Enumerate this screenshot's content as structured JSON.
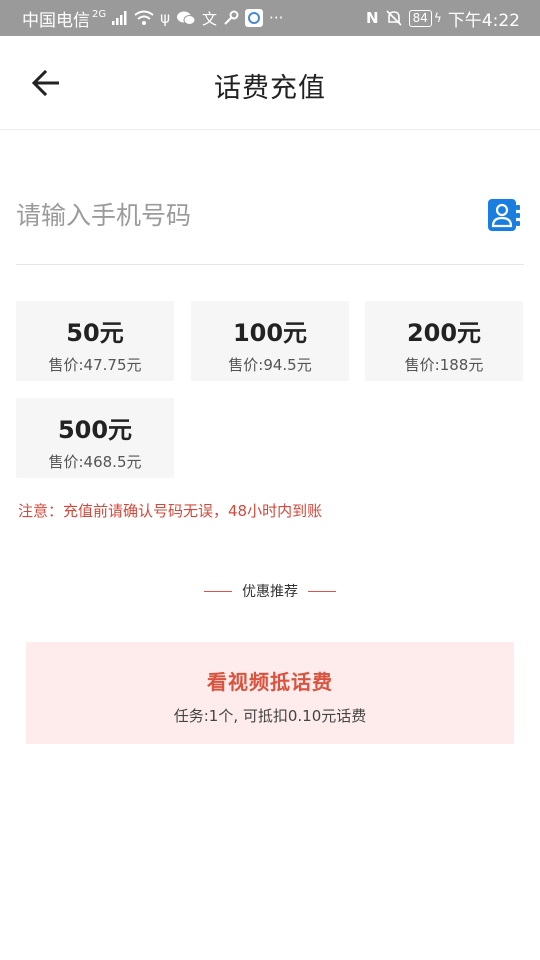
{
  "status_bar": {
    "carrier": "中国电信",
    "network": "2G",
    "battery": "84",
    "time": "下午4:22"
  },
  "nav": {
    "title": "话费充值"
  },
  "phone": {
    "placeholder": "请输入手机号码"
  },
  "amounts": [
    {
      "face": "50元",
      "price": "售价:47.75元"
    },
    {
      "face": "100元",
      "price": "售价:94.5元"
    },
    {
      "face": "200元",
      "price": "售价:188元"
    },
    {
      "face": "500元",
      "price": "售价:468.5元"
    }
  ],
  "notice": "注意：充值前请确认号码无误，48小时内到账",
  "promo": {
    "heading": "优惠推荐",
    "title": "看视频抵话费",
    "subtitle": "任务:1个, 可抵扣0.10元话费"
  },
  "colors": {
    "accent": "#d9533f",
    "contact_icon": "#1a7de0",
    "promo_bg": "#fdeceb",
    "card_bg": "#f6f6f6"
  }
}
